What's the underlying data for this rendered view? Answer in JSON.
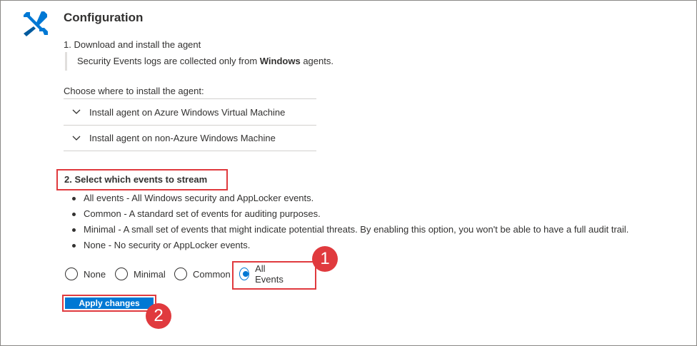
{
  "header": {
    "title": "Configuration",
    "icon": "tools-icon"
  },
  "step1": {
    "heading": "1. Download and install the agent",
    "note_prefix": "Security Events logs are collected only from ",
    "note_bold": "Windows",
    "note_suffix": " agents."
  },
  "install": {
    "heading": "Choose where to install the agent:",
    "options": [
      {
        "label": "Install agent on Azure Windows Virtual Machine"
      },
      {
        "label": "Install agent on non-Azure Windows Machine"
      }
    ]
  },
  "step2": {
    "heading": "2. Select which events to stream",
    "bullets": [
      "All events - All Windows security and AppLocker events.",
      "Common - A standard set of events for auditing purposes.",
      "Minimal - A small set of events that might indicate potential threats. By enabling this option, you won't be able to have a full audit trail.",
      "None - No security or AppLocker events."
    ]
  },
  "radio_options": [
    {
      "label": "None",
      "selected": false
    },
    {
      "label": "Minimal",
      "selected": false
    },
    {
      "label": "Common",
      "selected": false
    },
    {
      "label": "All Events",
      "selected": true
    }
  ],
  "apply_button": {
    "label": "Apply changes"
  },
  "callouts": {
    "one": "1",
    "two": "2"
  },
  "colors": {
    "accent": "#0078d4",
    "highlight": "#e03a3e",
    "icon": "#0078d4"
  }
}
